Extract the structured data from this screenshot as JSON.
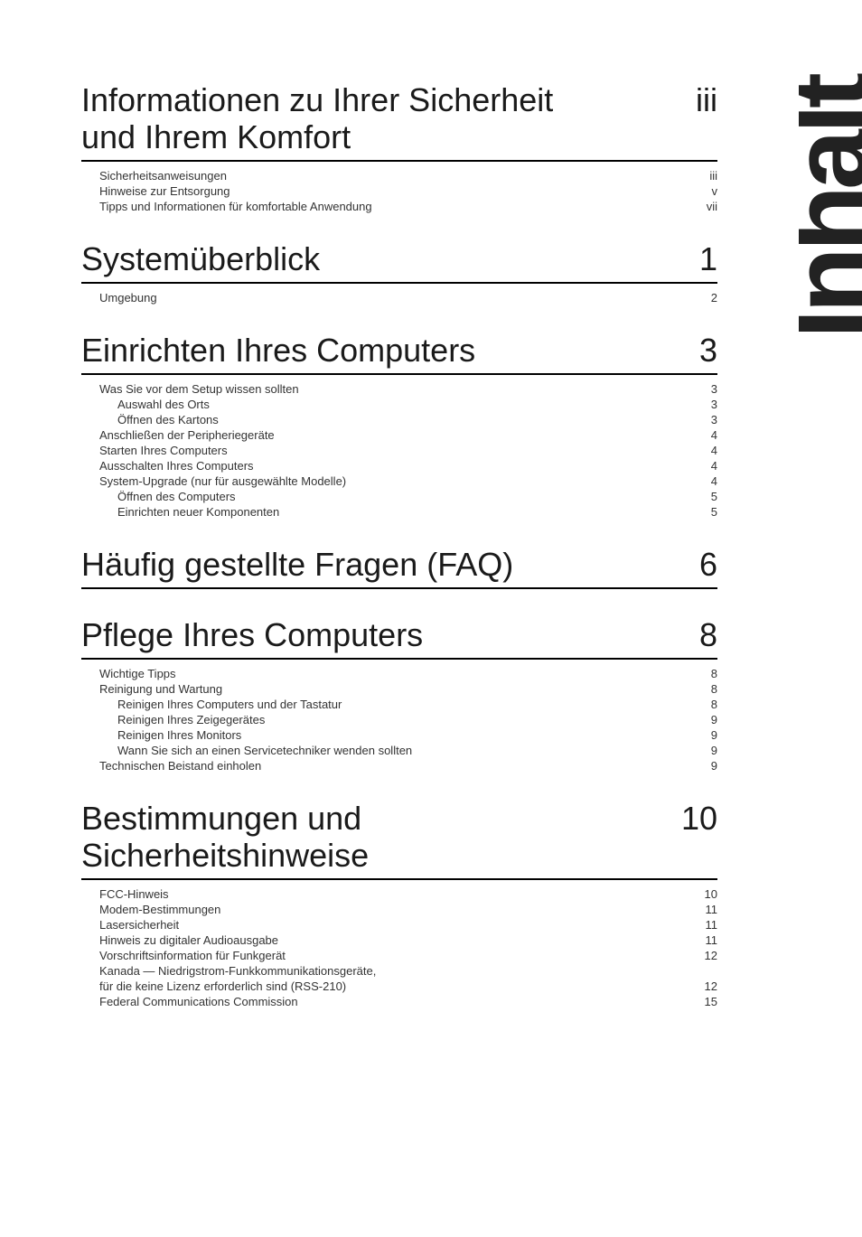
{
  "side_label": "Inhalt",
  "sections": [
    {
      "id": "safety",
      "title": "Informationen zu Ihrer Sicherheit\nund Ihrem Komfort",
      "page": "iii",
      "entries": [
        {
          "label": "Sicherheitsanweisungen",
          "page": "iii",
          "indent": 1
        },
        {
          "label": "Hinweise zur Entsorgung",
          "page": "v",
          "indent": 1
        },
        {
          "label": "Tipps und Informationen für komfortable Anwendung",
          "page": "vii",
          "indent": 1
        }
      ]
    },
    {
      "id": "overview",
      "title": "Systemüberblick",
      "page": "1",
      "entries": [
        {
          "label": "Umgebung",
          "page": "2",
          "indent": 1
        }
      ]
    },
    {
      "id": "setup",
      "title": "Einrichten Ihres Computers",
      "page": "3",
      "entries": [
        {
          "label": "Was Sie vor dem Setup wissen sollten",
          "page": "3",
          "indent": 1
        },
        {
          "label": "Auswahl des Orts",
          "page": "3",
          "indent": 2
        },
        {
          "label": "Öffnen des Kartons",
          "page": "3",
          "indent": 2
        },
        {
          "label": "Anschließen der Peripheriegeräte",
          "page": "4",
          "indent": 1
        },
        {
          "label": "Starten Ihres Computers",
          "page": "4",
          "indent": 1
        },
        {
          "label": "Ausschalten Ihres Computers",
          "page": "4",
          "indent": 1
        },
        {
          "label": "System-Upgrade (nur für ausgewählte Modelle)",
          "page": "4",
          "indent": 1
        },
        {
          "label": "Öffnen des Computers",
          "page": "5",
          "indent": 2
        },
        {
          "label": "Einrichten neuer Komponenten",
          "page": "5",
          "indent": 2
        }
      ]
    },
    {
      "id": "faq",
      "title": "Häufig gestellte Fragen (FAQ)",
      "page": "6",
      "entries": []
    },
    {
      "id": "care",
      "title": "Pflege Ihres Computers",
      "page": "8",
      "entries": [
        {
          "label": "Wichtige Tipps",
          "page": "8",
          "indent": 1
        },
        {
          "label": "Reinigung und Wartung",
          "page": "8",
          "indent": 1
        },
        {
          "label": "Reinigen Ihres Computers und der Tastatur",
          "page": "8",
          "indent": 2
        },
        {
          "label": "Reinigen Ihres Zeigegerätes",
          "page": "9",
          "indent": 2
        },
        {
          "label": "Reinigen Ihres Monitors",
          "page": "9",
          "indent": 2
        },
        {
          "label": "Wann Sie sich an einen Servicetechniker wenden sollten",
          "page": "9",
          "indent": 2
        },
        {
          "label": "Technischen Beistand einholen",
          "page": "9",
          "indent": 1
        }
      ]
    },
    {
      "id": "regulations",
      "title": "Bestimmungen und\nSicherheitshinweise",
      "page": "10",
      "entries": [
        {
          "label": "FCC-Hinweis",
          "page": "10",
          "indent": 1
        },
        {
          "label": "Modem-Bestimmungen",
          "page": "11",
          "indent": 1
        },
        {
          "label": "Lasersicherheit",
          "page": "11",
          "indent": 1
        },
        {
          "label": "Hinweis zu digitaler Audioausgabe",
          "page": "11",
          "indent": 1
        },
        {
          "label": "Vorschriftsinformation für Funkgerät",
          "page": "12",
          "indent": 1
        },
        {
          "label": "Kanada — Niedrigstrom-Funkkommunikationsgeräte,",
          "page": "",
          "indent": 1
        },
        {
          "label": "für die keine Lizenz erforderlich sind (RSS-210)",
          "page": "12",
          "indent": 1
        },
        {
          "label": "Federal Communications Commission",
          "page": "15",
          "indent": 1
        }
      ]
    }
  ]
}
